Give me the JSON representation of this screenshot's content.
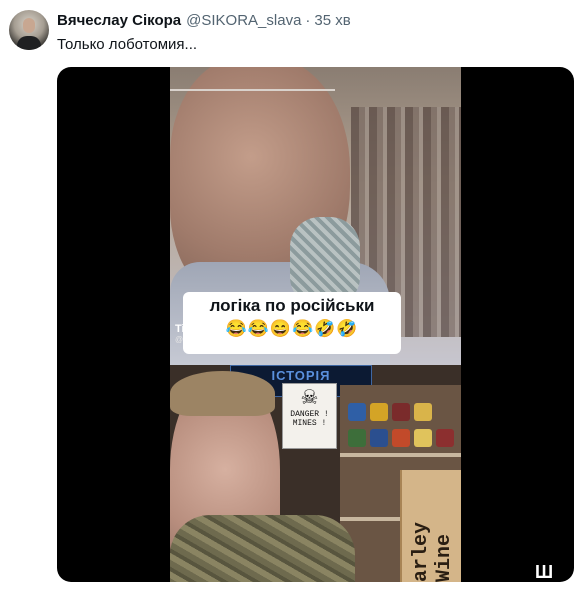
{
  "author": {
    "name": "Вячеслау Сікора",
    "handle": "@SIKORA_slava",
    "separator": "·",
    "time": "35 хв"
  },
  "tweet": {
    "text": "Только лоботомия..."
  },
  "video": {
    "caption_line": "логіка по російськи",
    "caption_emoji": "😂😂😄😂🤣🤣",
    "tiktok_brand": "TikTok",
    "tiktok_user": "@ nik_va",
    "banner": "ІСТОРІЯ",
    "sign_line1": "DANGER !",
    "sign_line2": "MINES !",
    "box_text": "arley Wine",
    "side_text": "Ш"
  }
}
